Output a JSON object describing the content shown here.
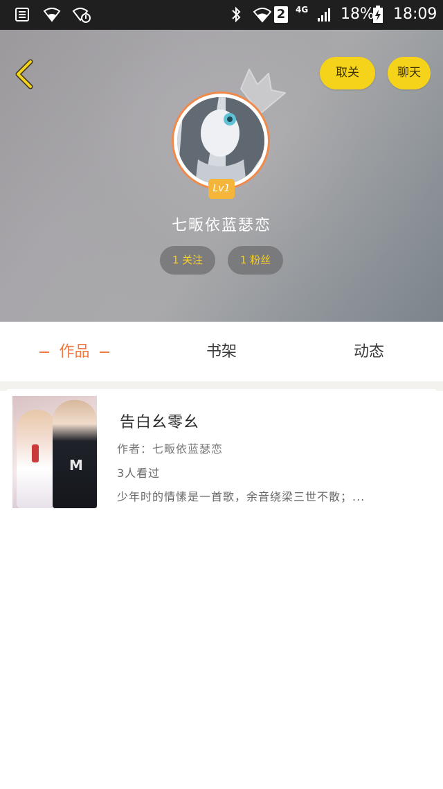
{
  "status_bar": {
    "network_badge": "2",
    "network_type": "4G",
    "battery": "18%",
    "time": "18:09",
    "icons": [
      "sim-card-icon",
      "wifi-icon",
      "wifi-shield-icon",
      "bluetooth-icon",
      "wifi-arrows-icon",
      "signal-icon",
      "battery-icon"
    ]
  },
  "header": {
    "cancel_follow_label": "取关",
    "chat_label": "聊天",
    "level": "Lv1",
    "username": "七畈依蓝瑟恋",
    "following": "1 关注",
    "fans": "1 粉丝",
    "accent_color": "#f5d31a"
  },
  "tabs": [
    {
      "label": "作品",
      "active": true
    },
    {
      "label": "书架",
      "active": false
    },
    {
      "label": "动态",
      "active": false
    }
  ],
  "book": {
    "title": "告白幺零幺",
    "author": "作者：七畈依蓝瑟恋",
    "views": "3人看过",
    "description": "少年时的情愫是一首歌，余音绕梁三世不散；...",
    "cover_text": "M"
  },
  "colors": {
    "active_tab": "#f07a44",
    "avatar_ring": "#f08a4b",
    "level_badge": "#f5b53a"
  }
}
